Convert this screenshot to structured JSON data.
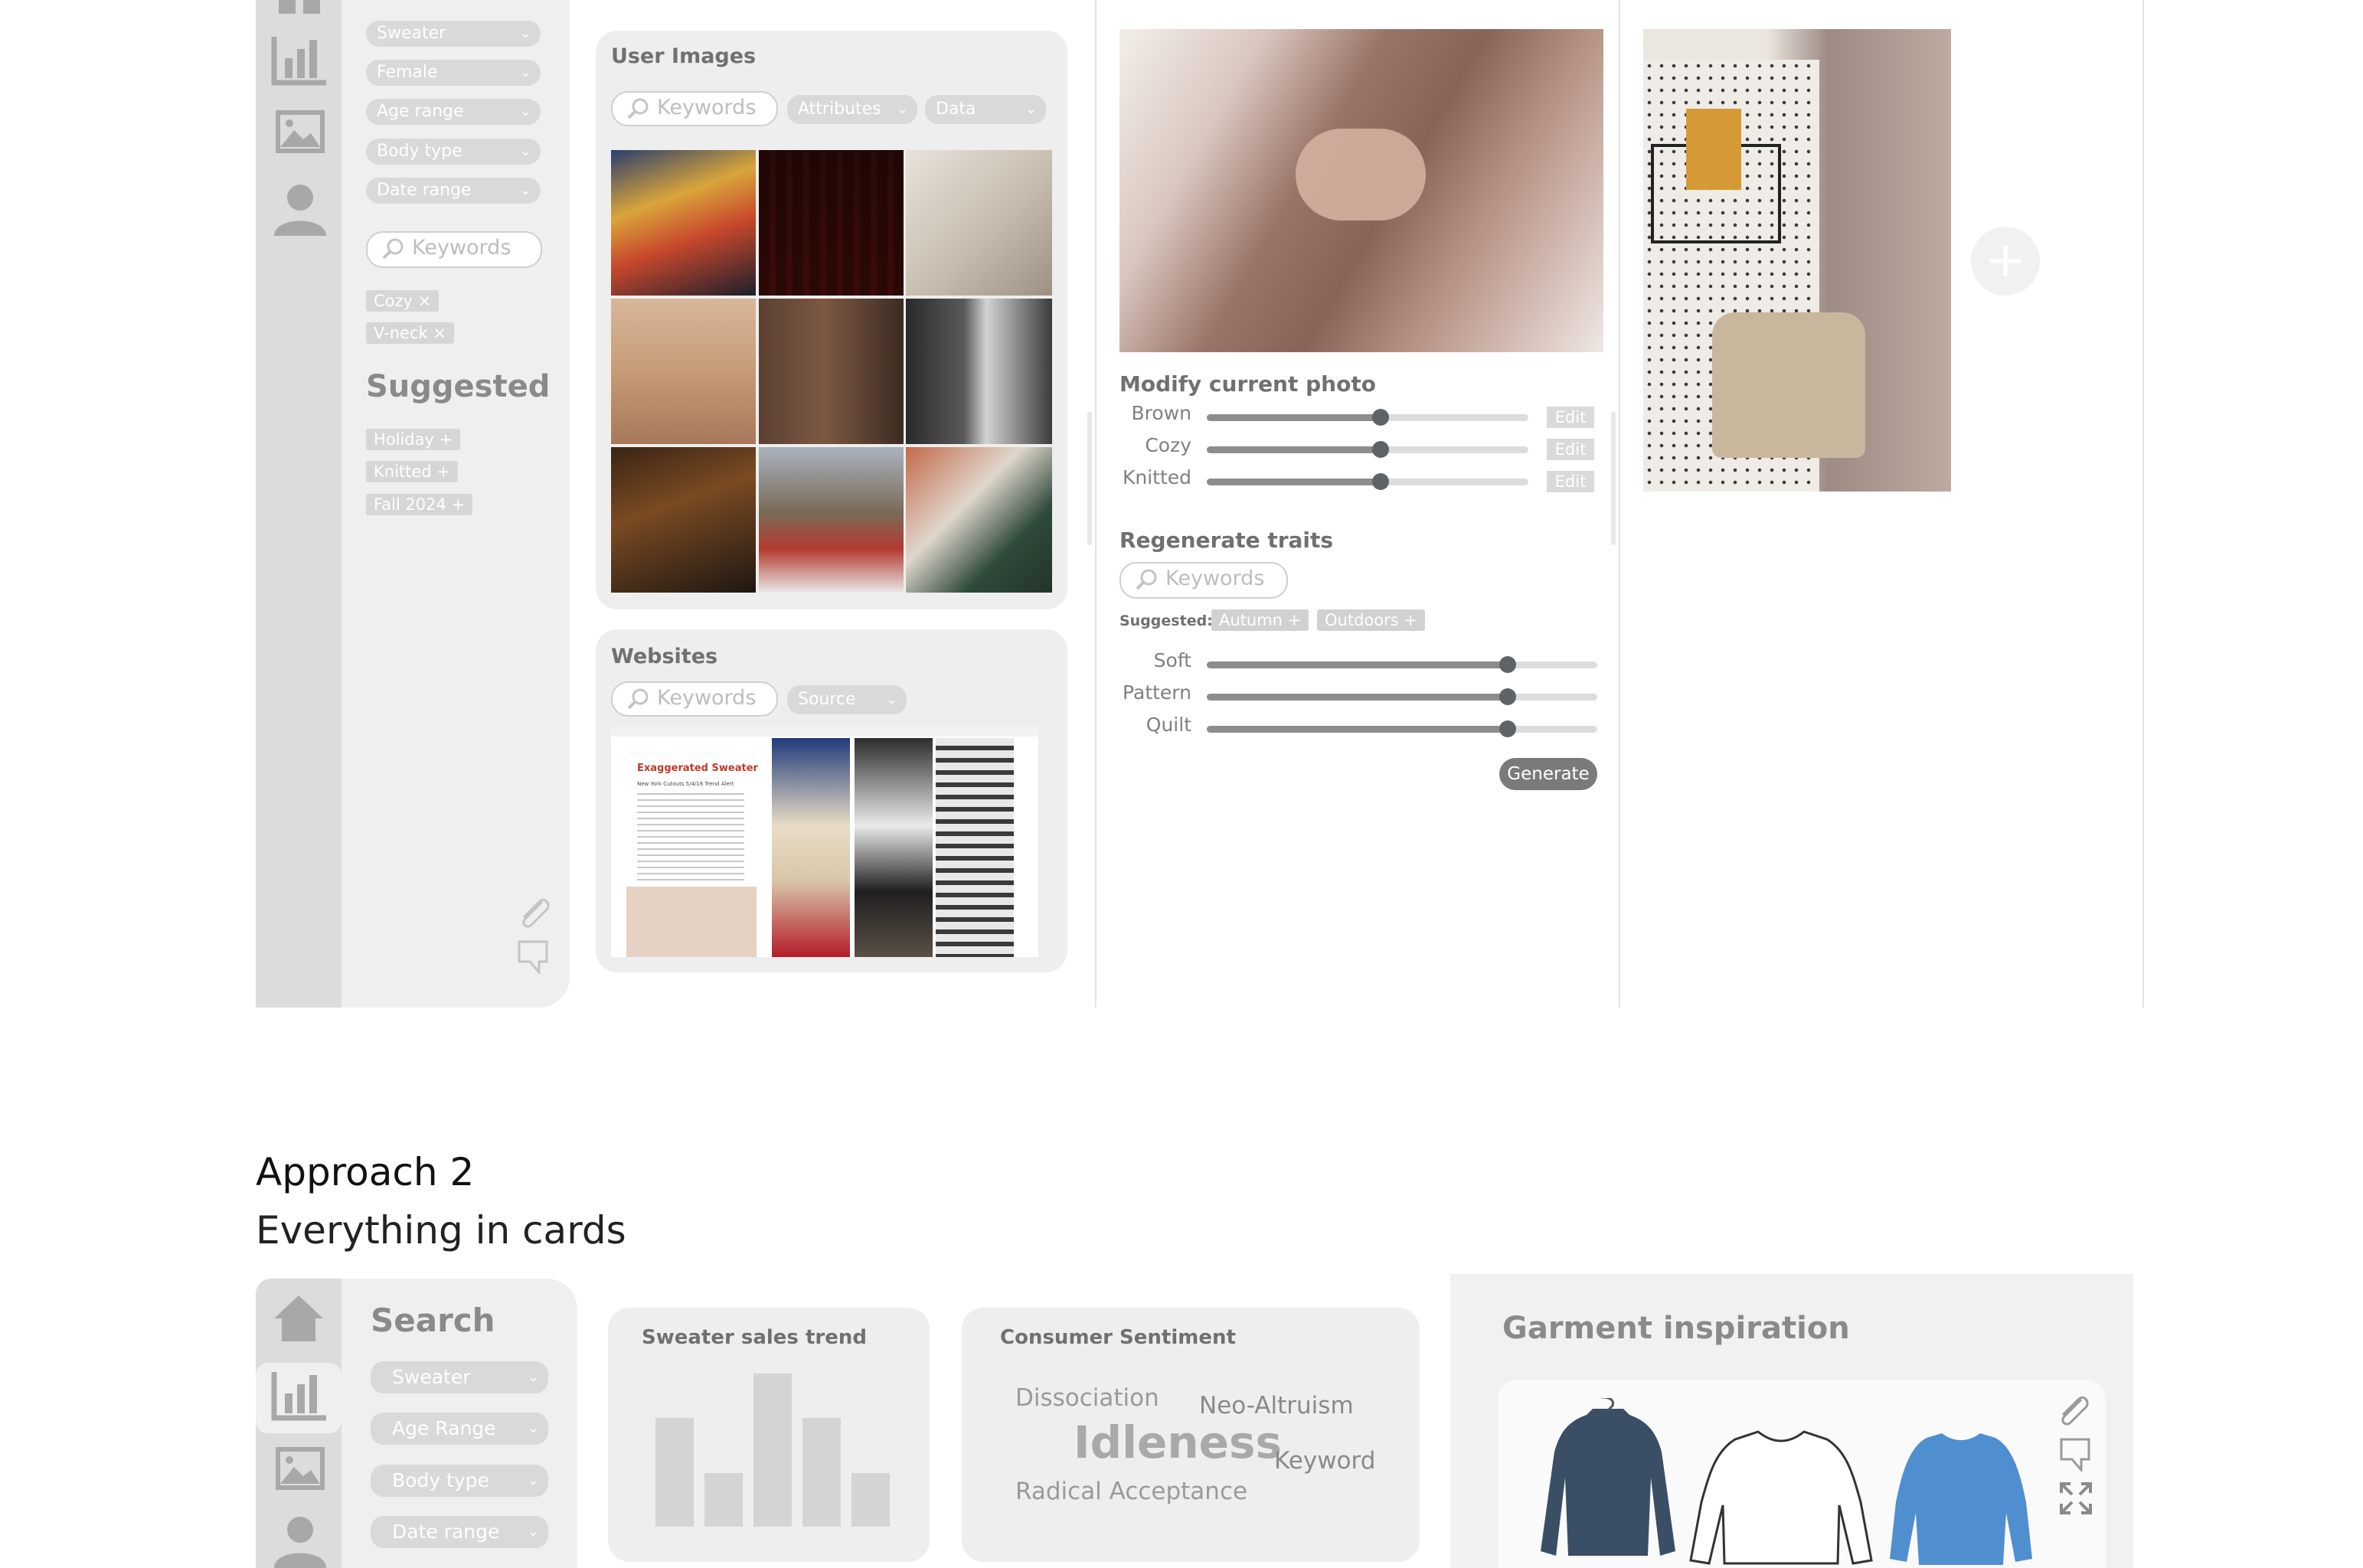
{
  "approach1": {
    "search": {
      "filters": [
        "Sweater",
        "Female",
        "Age range",
        "Body type",
        "Date range"
      ],
      "keywords_placeholder": "Keywords",
      "active_tags": [
        "Cozy ×",
        "V-neck ×"
      ],
      "suggested_title": "Suggested",
      "suggested_tags": [
        "Holiday +",
        "Knitted +",
        "Fall 2024 +"
      ]
    },
    "user_images": {
      "title": "User Images",
      "keywords_placeholder": "Keywords",
      "attributes_label": "Attributes",
      "data_label": "Data"
    },
    "websites": {
      "title": "Websites",
      "keywords_placeholder": "Keywords",
      "source_label": "Source",
      "article_title": "Exaggerated Sweater",
      "article_subtitle": "New York Cutouts 5/4/16 Trend Alert"
    },
    "ai_generate": {
      "modify_title": "Modify current photo",
      "modify_sliders": [
        {
          "label": "Brown",
          "value": 0.54
        },
        {
          "label": "Cozy",
          "value": 0.54
        },
        {
          "label": "Knitted",
          "value": 0.54
        }
      ],
      "edit_label": "Edit",
      "regenerate_title": "Regenerate traits",
      "keywords_placeholder": "Keywords",
      "suggested_label": "Suggested:",
      "suggested_tags": [
        "Autumn +",
        "Outdoors +"
      ],
      "trait_sliders": [
        {
          "label": "Soft",
          "value": 0.77
        },
        {
          "label": "Pattern",
          "value": 0.77
        },
        {
          "label": "Quilt",
          "value": 0.77
        }
      ],
      "generate_label": "Generate"
    },
    "moodboard": {
      "add_symbol": "+"
    }
  },
  "approach2": {
    "title": "Approach 2",
    "subtitle": "Everything in cards",
    "search": {
      "title": "Search",
      "filters": [
        "Sweater",
        "Age Range",
        "Body type",
        "Date range"
      ]
    },
    "sales_trend": {
      "title": "Sweater sales trend",
      "bar_values": [
        0.71,
        0.35,
        1.0,
        0.71,
        0.35
      ]
    },
    "sentiment": {
      "title": "Consumer Sentiment",
      "words": [
        "Dissociation",
        "Neo-Altruism",
        "Idleness",
        "Keyword",
        "Radical Acceptance"
      ]
    },
    "garment": {
      "title": "Garment inspiration"
    }
  },
  "colors": {
    "rail": "#dcdcdc",
    "panel": "#efefef",
    "pill": "#d9d9d9",
    "slider_fill": "#8d8d8d",
    "knob": "#5f6368"
  }
}
